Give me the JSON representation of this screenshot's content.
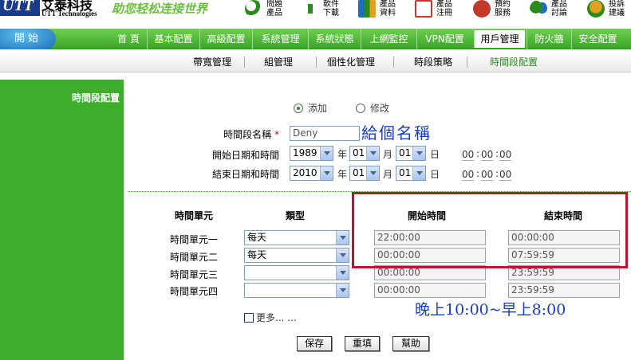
{
  "header": {
    "logo_text": "UTT",
    "company_cn": "艾泰科技",
    "company_en": "UTT Technologies",
    "slogan": "助您轻松连接世界",
    "links": [
      {
        "label": "問題\n產品",
        "icon": "search-icon",
        "color": "#2a8a1e"
      },
      {
        "label": "軟件\n下載",
        "icon": "download-icon",
        "color": "#2a8a1e"
      },
      {
        "label": "產品\n資料",
        "icon": "books-icon",
        "color": "#1c6fc0"
      },
      {
        "label": "產品\n注冊",
        "icon": "register-icon",
        "color": "#c0392b"
      },
      {
        "label": "預約\n服務",
        "icon": "phone-icon",
        "color": "#c0392b"
      },
      {
        "label": "產品\n討論",
        "icon": "users-icon",
        "color": "#2a8a1e"
      },
      {
        "label": "投訴\n建議",
        "icon": "suggest-icon",
        "color": "#e0a020"
      }
    ]
  },
  "main_nav": {
    "start_label": "開始",
    "items": [
      "首 頁",
      "基本配置",
      "高級配置",
      "系統管理",
      "系統狀態",
      "上網監控",
      "VPN配置",
      "用戶管理",
      "防火牆",
      "安全配置"
    ],
    "active_index": 7
  },
  "sub_nav": {
    "items": [
      "帶寬管理",
      "組管理",
      "個性化管理",
      "時段策略",
      "時間段配置"
    ],
    "active_index": 4
  },
  "sidebar": {
    "title": "時間段配置"
  },
  "form": {
    "mode_add": "添加",
    "mode_edit": "修改",
    "name_label": "時間段名稱",
    "required_mark": "*",
    "name_value": "Deny",
    "name_annotation": "給個名稱",
    "start_label": "開始日期和時間",
    "end_label": "結束日期和時間",
    "start_date": {
      "year": "1989",
      "month": "01",
      "day": "01"
    },
    "end_date": {
      "year": "2010",
      "month": "01",
      "day": "01"
    },
    "unit_year": "年",
    "unit_month": "月",
    "unit_day": "日",
    "start_time": {
      "h": "00",
      "m": "00",
      "s": "00"
    },
    "end_time": {
      "h": "00",
      "m": "00",
      "s": "00"
    },
    "colon": ":"
  },
  "table": {
    "headers": [
      "時間單元",
      "類型",
      "開始時間",
      "結束時間"
    ],
    "rows": [
      {
        "label": "時間單元一",
        "type": "每天",
        "start": "22:00:00",
        "end": "00:00:00"
      },
      {
        "label": "時間單元二",
        "type": "每天",
        "start": "00:00:00",
        "end": "07:59:59"
      },
      {
        "label": "時間單元三",
        "type": "",
        "start": "00:00:00",
        "end": "23:59:59"
      },
      {
        "label": "時間單元四",
        "type": "",
        "start": "00:00:00",
        "end": "23:59:59"
      }
    ],
    "annotation": "晚上10:00~早上8:00",
    "more_label": "更多... ..."
  },
  "buttons": {
    "save": "保存",
    "reset": "重填",
    "help": "幫助"
  },
  "colors": {
    "green": "#3fad2c",
    "highlight": "#c8102e",
    "annotation": "#1a3acc"
  }
}
